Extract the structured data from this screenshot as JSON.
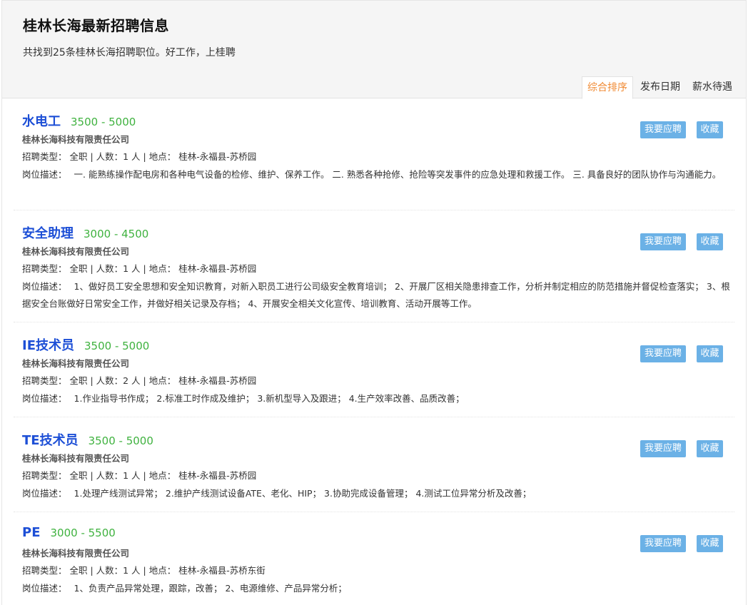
{
  "header": {
    "title": "桂林长海最新招聘信息",
    "subtitle": "共找到25条桂林长海招聘职位。好工作，上桂聘"
  },
  "sort_tabs": [
    {
      "label": "综合排序",
      "active": true
    },
    {
      "label": "发布日期",
      "active": false
    },
    {
      "label": "薪水待遇",
      "active": false
    }
  ],
  "buttons": {
    "apply": "我要应聘",
    "favorite": "收藏"
  },
  "jobs": [
    {
      "title": "水电工",
      "salary": "3500 - 5000",
      "company": "桂林长海科技有限责任公司",
      "meta": "招聘类型：  全职 | 人数：1 人 | 地点：  桂林-永福县-苏桥园",
      "desc_label": "岗位描述：",
      "desc": "一. 能熟练操作配电房和各种电气设备的检修、维护、保养工作。 二. 熟悉各种抢修、抢险等突发事件的应急处理和救援工作。 三. 具备良好的团队协作与沟通能力。"
    },
    {
      "title": "安全助理",
      "salary": "3000 - 4500",
      "company": "桂林长海科技有限责任公司",
      "meta": "招聘类型：  全职 | 人数：1 人 | 地点：  桂林-永福县-苏桥园",
      "desc_label": "岗位描述：",
      "desc": "1、做好员工安全思想和安全知识教育，对新入职员工进行公司级安全教育培训；  2、开展厂区相关隐患排查工作，分析并制定相应的防范措施并督促检查落实；  3、根据安全台账做好日常安全工作，并做好相关记录及存档；  4、开展安全相关文化宣传、培训教育、活动开展等工作。"
    },
    {
      "title": "IE技术员",
      "salary": "3500 - 5000",
      "company": "桂林长海科技有限责任公司",
      "meta": "招聘类型：  全职 | 人数：2 人 | 地点：  桂林-永福县-苏桥园",
      "desc_label": "岗位描述：",
      "desc": "1.作业指导书作成；  2.标准工时作成及维护；  3.新机型导入及跟进；  4.生产效率改善、品质改善；"
    },
    {
      "title": "TE技术员",
      "salary": "3500 - 5000",
      "company": "桂林长海科技有限责任公司",
      "meta": "招聘类型：  全职 | 人数：1 人 | 地点：  桂林-永福县-苏桥园",
      "desc_label": "岗位描述：",
      "desc": "1.处理产线测试异常；  2.维护产线测试设备ATE、老化、HIP；  3.协助完成设备管理；  4.测试工位异常分析及改善；"
    },
    {
      "title": "PE",
      "salary": "3000 - 5500",
      "company": "桂林长海科技有限责任公司",
      "meta": "招聘类型：  全职 | 人数：1 人 | 地点：  桂林-永福县-苏桥东街",
      "desc_label": "岗位描述：",
      "desc": "1、负责产品异常处理，跟踪，改善；  2、电源维修、产品异常分析；"
    }
  ],
  "colors": {
    "title_link": "#1d4fd6",
    "salary": "#3fb23f",
    "active_tab": "#f08a33",
    "button": "#6bb1e6"
  }
}
